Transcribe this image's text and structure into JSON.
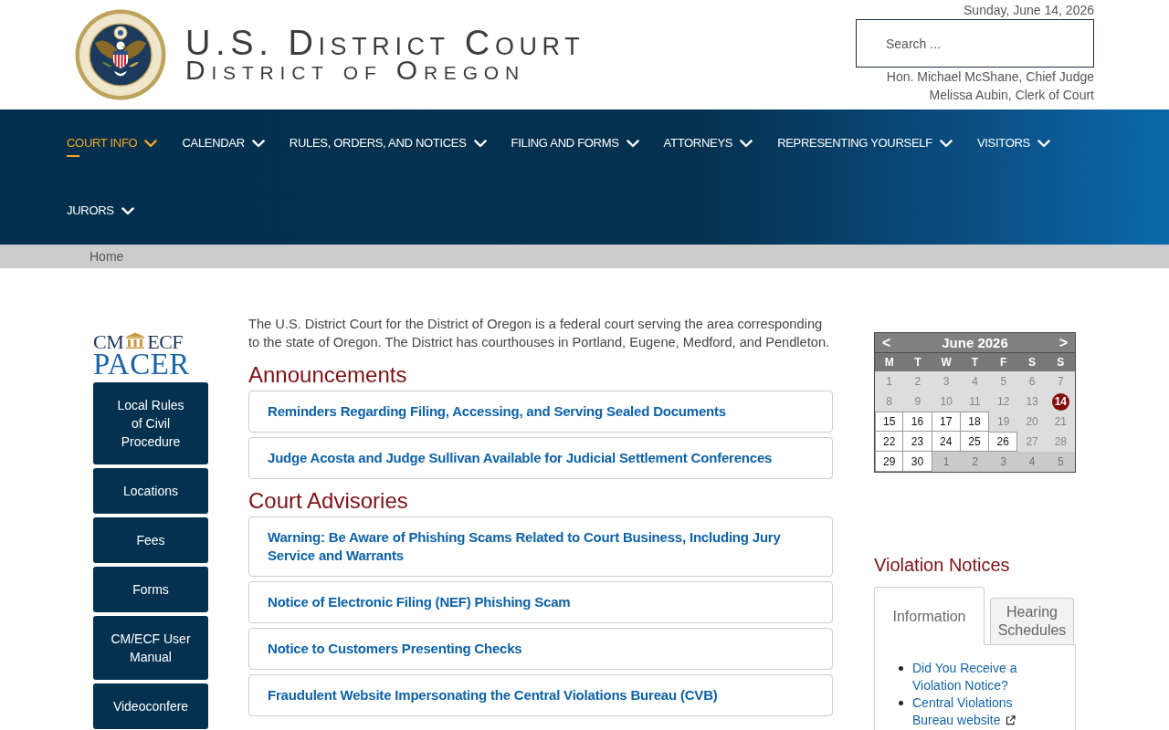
{
  "header": {
    "title": "U.S. District Court",
    "subtitle": "District of Oregon",
    "date": "Sunday, June 14, 2026",
    "search": {
      "placeholder": "Search ..."
    },
    "officials": [
      "Hon. Michael McShane, Chief Judge",
      "Melissa Aubin, Clerk of Court"
    ]
  },
  "nav": [
    {
      "label": "COURT INFO",
      "selected": true
    },
    {
      "label": "CALENDAR",
      "selected": false
    },
    {
      "label": "RULES, ORDERS, AND NOTICES",
      "selected": false
    },
    {
      "label": "FILING AND FORMS",
      "selected": false
    },
    {
      "label": "ATTORNEYS",
      "selected": false
    },
    {
      "label": "REPRESENTING YOURSELF",
      "selected": false
    },
    {
      "label": "VISITORS",
      "selected": false
    },
    {
      "label": "JURORS",
      "selected": false
    }
  ],
  "breadcrumb": [
    "Home"
  ],
  "sidebar": {
    "logo": {
      "top_left": "CM",
      "top_right": "ECF",
      "bottom": "PACER"
    },
    "links": [
      "Local Rules of Civil Procedure",
      "Locations",
      "Fees",
      "Forms",
      "CM/ECF User Manual",
      "Videoconfere"
    ]
  },
  "main": {
    "intro": "The U.S. District Court for the District of Oregon is a federal court serving the area corresponding to the state of Oregon. The District has courthouses in Portland, Eugene, Medford, and Pendleton.",
    "sections": [
      {
        "heading": "Announcements",
        "items": [
          "Reminders Regarding Filing, Accessing, and Serving Sealed Documents",
          "Judge Acosta and Judge Sullivan Available for Judicial Settlement Conferences"
        ]
      },
      {
        "heading": "Court Advisories",
        "items": [
          "Warning: Be Aware of Phishing Scams Related to Court Business, Including Jury Service and Warrants",
          "Notice of Electronic Filing (NEF) Phishing Scam",
          "Notice to Customers Presenting Checks",
          "Fraudulent Website Impersonating the Central Violations Bureau (CVB)"
        ]
      }
    ]
  },
  "calendar": {
    "prev": "<",
    "title": "June 2026",
    "next": ">",
    "weekdays": [
      "M",
      "T",
      "W",
      "T",
      "F",
      "S",
      "S"
    ],
    "days": [
      {
        "label": "1",
        "kind": "inactive"
      },
      {
        "label": "2",
        "kind": "inactive"
      },
      {
        "label": "3",
        "kind": "inactive"
      },
      {
        "label": "4",
        "kind": "inactive"
      },
      {
        "label": "5",
        "kind": "inactive"
      },
      {
        "label": "6",
        "kind": "inactive"
      },
      {
        "label": "7",
        "kind": "inactive"
      },
      {
        "label": "8",
        "kind": "inactive"
      },
      {
        "label": "9",
        "kind": "inactive"
      },
      {
        "label": "10",
        "kind": "inactive"
      },
      {
        "label": "11",
        "kind": "inactive"
      },
      {
        "label": "12",
        "kind": "inactive"
      },
      {
        "label": "13",
        "kind": "inactive"
      },
      {
        "label": "14",
        "kind": "today"
      },
      {
        "label": "15",
        "kind": "active"
      },
      {
        "label": "16",
        "kind": "active"
      },
      {
        "label": "17",
        "kind": "active"
      },
      {
        "label": "18",
        "kind": "active"
      },
      {
        "label": "19",
        "kind": "inactive"
      },
      {
        "label": "20",
        "kind": "inactive"
      },
      {
        "label": "21",
        "kind": "inactive"
      },
      {
        "label": "22",
        "kind": "active"
      },
      {
        "label": "23",
        "kind": "active"
      },
      {
        "label": "24",
        "kind": "active"
      },
      {
        "label": "25",
        "kind": "active"
      },
      {
        "label": "26",
        "kind": "active"
      },
      {
        "label": "27",
        "kind": "inactive"
      },
      {
        "label": "28",
        "kind": "inactive"
      },
      {
        "label": "29",
        "kind": "active"
      },
      {
        "label": "30",
        "kind": "active"
      },
      {
        "label": "1",
        "kind": "outside"
      },
      {
        "label": "2",
        "kind": "outside"
      },
      {
        "label": "3",
        "kind": "outside"
      },
      {
        "label": "4",
        "kind": "outside"
      },
      {
        "label": "5",
        "kind": "outside"
      }
    ]
  },
  "violation_notices": {
    "heading": "Violation Notices",
    "tabs": [
      {
        "label": "Information",
        "selected": true
      },
      {
        "label": "Hearing Schedules",
        "selected": false
      }
    ],
    "links": [
      {
        "label": "Did You Receive a Violation Notice?",
        "external": false
      },
      {
        "label": "Central Violations Bureau website",
        "external": true
      }
    ]
  }
}
